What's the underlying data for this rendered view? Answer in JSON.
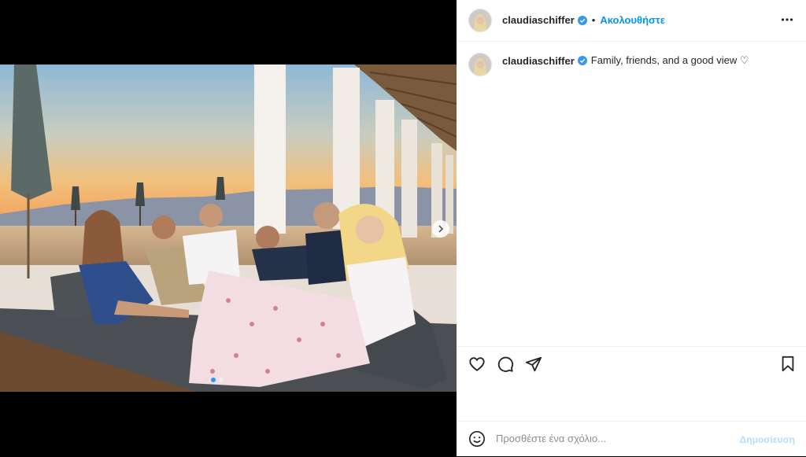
{
  "header": {
    "username": "claudiaschiffer",
    "separator": "•",
    "follow_label": "Ακολουθήστε"
  },
  "caption": {
    "username": "claudiaschiffer",
    "text": "Family, friends, and a good view ♡"
  },
  "actions": {
    "icons": [
      "heart-icon",
      "comment-icon",
      "share-icon",
      "bookmark-icon"
    ]
  },
  "comment": {
    "placeholder": "Προσθέστε ένα σχόλιο...",
    "post_label": "Δημοσίευση"
  },
  "carousel": {
    "total_slides": 2,
    "current_slide": 1
  },
  "colors": {
    "accent": "#0095f6",
    "verified": "#3897f0",
    "post_disabled": "#b2dffc"
  }
}
